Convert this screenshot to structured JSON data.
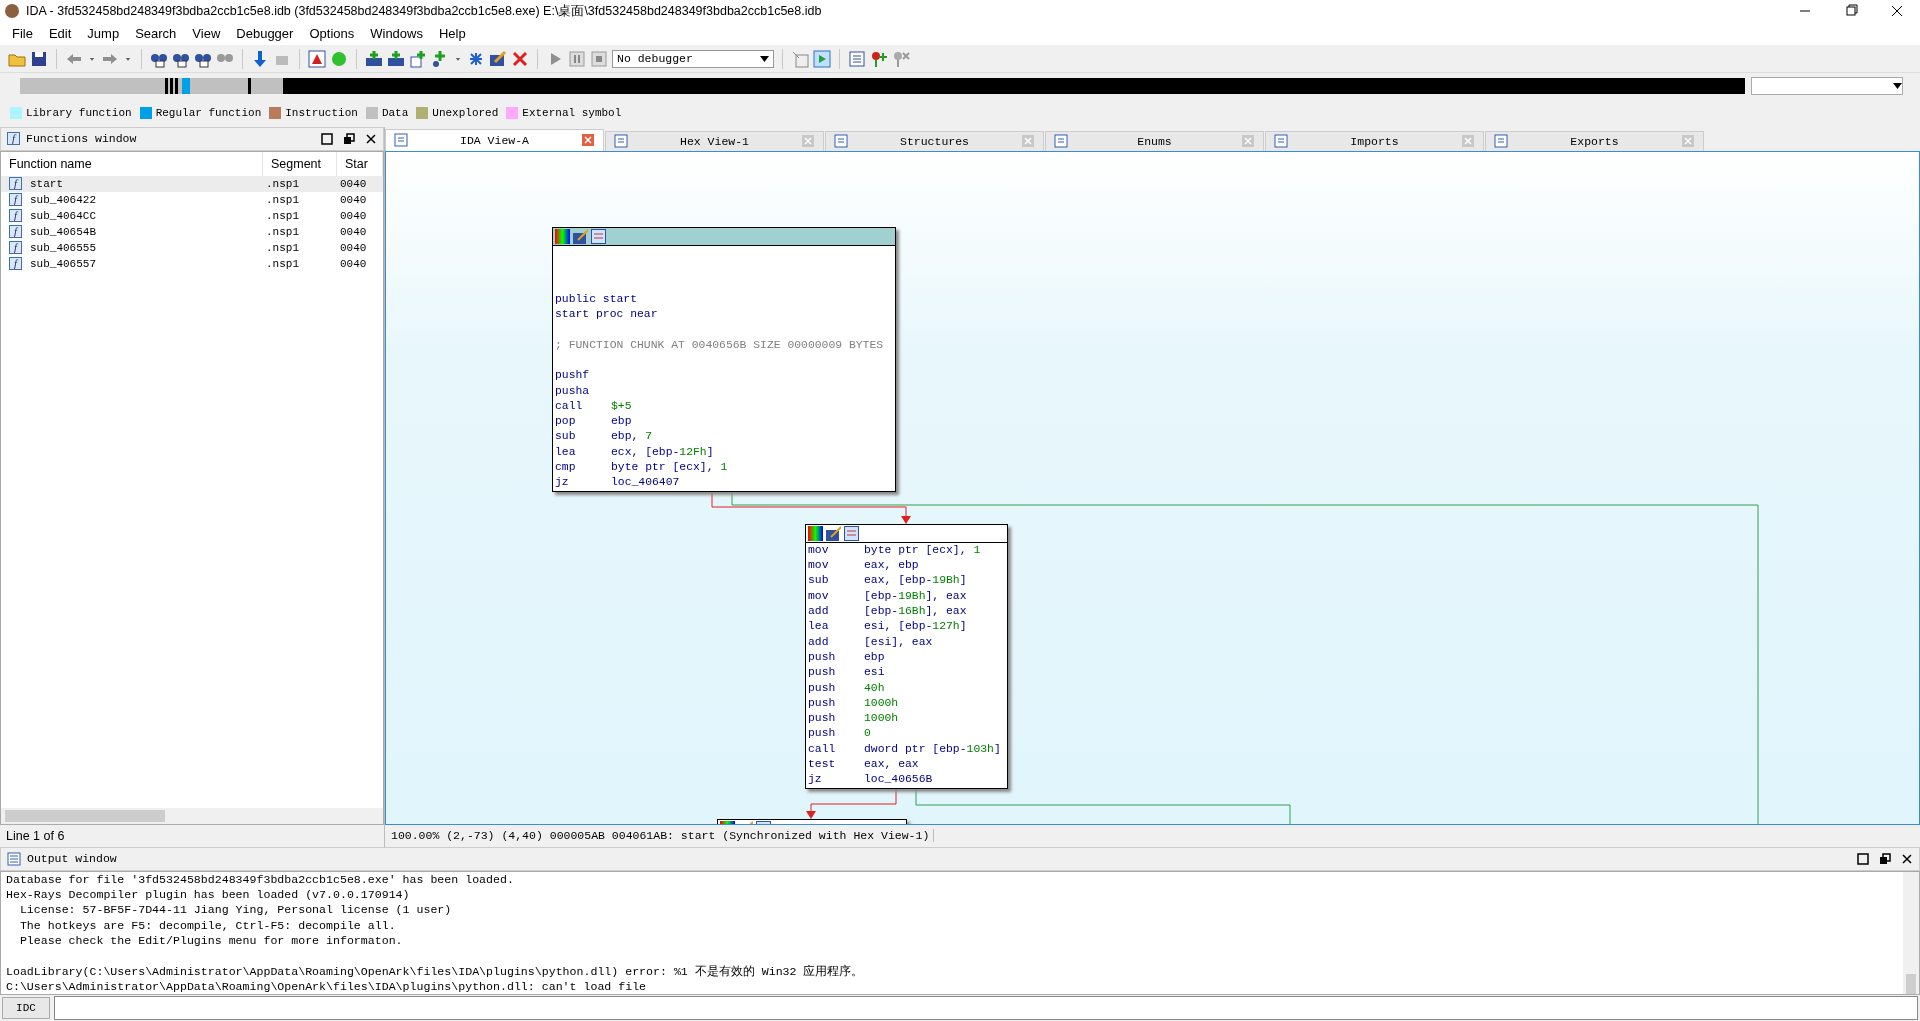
{
  "window": {
    "title": "IDA - 3fd532458bd248349f3bdba2ccb1c5e8.idb (3fd532458bd248349f3bdba2ccb1c5e8.exe) E:\\桌面\\3fd532458bd248349f3bdba2ccb1c5e8.idb"
  },
  "menu": [
    {
      "label": "File"
    },
    {
      "label": "Edit"
    },
    {
      "label": "Jump"
    },
    {
      "label": "Search"
    },
    {
      "label": "View"
    },
    {
      "label": "Debugger"
    },
    {
      "label": "Options"
    },
    {
      "label": "Windows"
    },
    {
      "label": "Help"
    }
  ],
  "toolbar": {
    "debugger_select": "No debugger"
  },
  "legend": [
    {
      "label": "Library function",
      "color": "#aaf5ff"
    },
    {
      "label": "Regular function",
      "color": "#00a0e8"
    },
    {
      "label": "Instruction",
      "color": "#b87c5c"
    },
    {
      "label": "Data",
      "color": "#c0c0c0"
    },
    {
      "label": "Unexplored",
      "color": "#b0b070"
    },
    {
      "label": "External symbol",
      "color": "#ffa8ff"
    }
  ],
  "functions_window": {
    "icon": "f",
    "title": "Functions window",
    "columns": [
      "Function name",
      "Segment",
      "Star"
    ],
    "rows": [
      {
        "icon": "f",
        "name": "start",
        "segment": ".nsp1",
        "start": "0040",
        "selected": true
      },
      {
        "icon": "f",
        "name": "sub_406422",
        "segment": ".nsp1",
        "start": "0040",
        "selected": false
      },
      {
        "icon": "f",
        "name": "sub_4064CC",
        "segment": ".nsp1",
        "start": "0040",
        "selected": false
      },
      {
        "icon": "f",
        "name": "sub_40654B",
        "segment": ".nsp1",
        "start": "0040",
        "selected": false
      },
      {
        "icon": "f",
        "name": "sub_406555",
        "segment": ".nsp1",
        "start": "0040",
        "selected": false
      },
      {
        "icon": "f",
        "name": "sub_406557",
        "segment": ".nsp1",
        "start": "0040",
        "selected": false
      }
    ],
    "status": "Line 1 of 6"
  },
  "tabs": [
    {
      "label": "IDA View-A",
      "selected": true
    },
    {
      "label": "Hex View-1",
      "selected": false
    },
    {
      "label": "Structures",
      "selected": false
    },
    {
      "label": "Enums",
      "selected": false
    },
    {
      "label": "Imports",
      "selected": false
    },
    {
      "label": "Exports",
      "selected": false
    }
  ],
  "graph": {
    "blocks": [
      {
        "highlighted": true,
        "lines": [
          {
            "kind": "blank"
          },
          {
            "kind": "blank"
          },
          {
            "kind": "blank"
          },
          {
            "kind": "decl",
            "text": "public start"
          },
          {
            "kind": "decl",
            "text": "start proc near"
          },
          {
            "kind": "blank"
          },
          {
            "kind": "comment",
            "text": "; FUNCTION CHUNK AT 0040656B SIZE 00000009 BYTES"
          },
          {
            "kind": "blank"
          },
          {
            "kind": "insn",
            "mnemonic": "pushf"
          },
          {
            "kind": "insn",
            "mnemonic": "pusha"
          },
          {
            "kind": "insn",
            "mnemonic": "call",
            "operands": [
              {
                "kind": "number",
                "t": "$+5"
              }
            ]
          },
          {
            "kind": "insn",
            "mnemonic": "pop",
            "operands": [
              {
                "kind": "register",
                "t": "ebp"
              }
            ]
          },
          {
            "kind": "insn",
            "mnemonic": "sub",
            "operands": [
              {
                "kind": "register",
                "t": "ebp, "
              },
              {
                "kind": "number",
                "t": "7"
              }
            ]
          },
          {
            "kind": "insn",
            "mnemonic": "lea",
            "operands": [
              {
                "kind": "register",
                "t": "ecx, [ebp-"
              },
              {
                "kind": "number",
                "t": "12Fh"
              },
              {
                "kind": "register",
                "t": "]"
              }
            ]
          },
          {
            "kind": "insn",
            "mnemonic": "cmp",
            "operands": [
              {
                "kind": "register",
                "t": "byte ptr [ecx], "
              },
              {
                "kind": "number",
                "t": "1"
              }
            ]
          },
          {
            "kind": "insn",
            "mnemonic": "jz",
            "operands": [
              {
                "kind": "register",
                "t": "loc_406407"
              }
            ]
          }
        ]
      },
      {
        "highlighted": false,
        "lines": [
          {
            "kind": "insn",
            "mnemonic": "mov",
            "operands": [
              {
                "kind": "register",
                "t": "byte ptr [ecx], "
              },
              {
                "kind": "number",
                "t": "1"
              }
            ]
          },
          {
            "kind": "insn",
            "mnemonic": "mov",
            "operands": [
              {
                "kind": "register",
                "t": "eax, ebp"
              }
            ]
          },
          {
            "kind": "insn",
            "mnemonic": "sub",
            "operands": [
              {
                "kind": "register",
                "t": "eax, [ebp-"
              },
              {
                "kind": "number",
                "t": "19Bh"
              },
              {
                "kind": "register",
                "t": "]"
              }
            ]
          },
          {
            "kind": "insn",
            "mnemonic": "mov",
            "operands": [
              {
                "kind": "register",
                "t": "[ebp-"
              },
              {
                "kind": "number",
                "t": "19Bh"
              },
              {
                "kind": "register",
                "t": "], eax"
              }
            ]
          },
          {
            "kind": "insn",
            "mnemonic": "add",
            "operands": [
              {
                "kind": "register",
                "t": "[ebp-"
              },
              {
                "kind": "number",
                "t": "16Bh"
              },
              {
                "kind": "register",
                "t": "], eax"
              }
            ]
          },
          {
            "kind": "insn",
            "mnemonic": "lea",
            "operands": [
              {
                "kind": "register",
                "t": "esi, [ebp-"
              },
              {
                "kind": "number",
                "t": "127h"
              },
              {
                "kind": "register",
                "t": "]"
              }
            ]
          },
          {
            "kind": "insn",
            "mnemonic": "add",
            "operands": [
              {
                "kind": "register",
                "t": "[esi], eax"
              }
            ]
          },
          {
            "kind": "insn",
            "mnemonic": "push",
            "operands": [
              {
                "kind": "register",
                "t": "ebp"
              }
            ]
          },
          {
            "kind": "insn",
            "mnemonic": "push",
            "operands": [
              {
                "kind": "register",
                "t": "esi"
              }
            ]
          },
          {
            "kind": "insn",
            "mnemonic": "push",
            "operands": [
              {
                "kind": "number",
                "t": "40h"
              }
            ]
          },
          {
            "kind": "insn",
            "mnemonic": "push",
            "operands": [
              {
                "kind": "number",
                "t": "1000h"
              }
            ]
          },
          {
            "kind": "insn",
            "mnemonic": "push",
            "operands": [
              {
                "kind": "number",
                "t": "1000h"
              }
            ]
          },
          {
            "kind": "insn",
            "mnemonic": "push",
            "operands": [
              {
                "kind": "number",
                "t": "0"
              }
            ]
          },
          {
            "kind": "insn",
            "mnemonic": "call",
            "operands": [
              {
                "kind": "register",
                "t": "dword ptr [ebp-"
              },
              {
                "kind": "number",
                "t": "103h"
              },
              {
                "kind": "register",
                "t": "]"
              }
            ]
          },
          {
            "kind": "insn",
            "mnemonic": "test",
            "operands": [
              {
                "kind": "register",
                "t": "eax, eax"
              }
            ]
          },
          {
            "kind": "insn",
            "mnemonic": "jz",
            "operands": [
              {
                "kind": "register",
                "t": "loc_40656B"
              }
            ]
          }
        ]
      },
      {
        "highlighted": false
      }
    ],
    "status": "100.00% (2,-73) (4,40) 000005AB 004061AB: start (Synchronized with Hex View-1)"
  },
  "output_window": {
    "title": "Output window",
    "lines": [
      {
        "kind": "text",
        "text": "Database for file '3fd532458bd248349f3bdba2ccb1c5e8.exe' has been loaded."
      },
      {
        "kind": "text",
        "text": "Hex-Rays Decompiler plugin has been loaded (v7.0.0.170914)"
      },
      {
        "kind": "text",
        "text": "  License: 57-BF5F-7D44-11 Jiang Ying, Personal license (1 user)"
      },
      {
        "kind": "text",
        "text": "  The hotkeys are F5: decompile, Ctrl-F5: decompile all."
      },
      {
        "kind": "text",
        "text": "  Please check the Edit/Plugins menu for more informaton."
      },
      {
        "kind": "blank"
      },
      {
        "kind": "text",
        "text": "LoadLibrary(C:\\Users\\Administrator\\AppData\\Roaming\\OpenArk\\files\\IDA\\plugins\\python.dll) error: %1 不是有效的 Win32 应用程序。"
      },
      {
        "kind": "text",
        "text": "C:\\Users\\Administrator\\AppData\\Roaming\\OpenArk\\files\\IDA\\plugins\\python.dll: can't load file"
      }
    ]
  },
  "command_bar": {
    "language": "IDC"
  }
}
